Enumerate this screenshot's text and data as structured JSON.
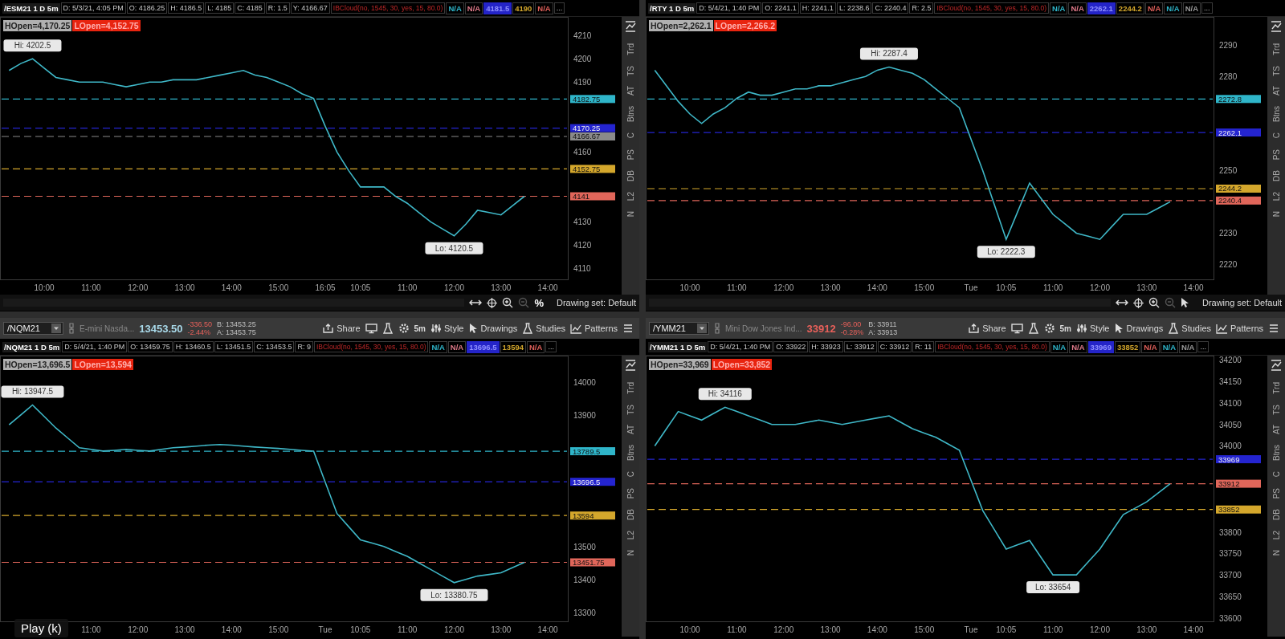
{
  "panels": [
    {
      "info_bar": {
        "symbol": "/ESM21 1 D 5m",
        "fields": [
          "D: 5/3/21, 4:05 PM",
          "O: 4186.25",
          "H: 4186.5",
          "L: 4185",
          "C: 4185",
          "R: 1.5",
          "Y: 4166.67"
        ],
        "study": "IBCloud(no, 1545, 30, yes, 15, 80.0)",
        "values": [
          {
            "text": "N/A",
            "color": "#2fb5c9",
            "highlight": false
          },
          {
            "text": "N/A",
            "color": "#e07a8a",
            "highlight": false
          },
          {
            "text": "4181.5",
            "color": "#2424c8",
            "highlight": true
          },
          {
            "text": "4190",
            "color": "#d4a72c",
            "highlight": false
          },
          {
            "text": "N/A",
            "color": "#e0605a",
            "highlight": false
          }
        ],
        "more": "..."
      },
      "open_labels": [
        {
          "text": "HOpen=4,170.25",
          "color": "#b0b0b0"
        },
        {
          "text": "LOpen=4,152.75",
          "color": "#e8240f"
        }
      ],
      "extremes": {
        "high": "Hi: 4202.5",
        "low": "Lo: 4120.5"
      },
      "side_tabs": [
        "Trd",
        "TS",
        "AT",
        "Btns",
        "C",
        "PS",
        "DB",
        "L2",
        "N"
      ],
      "chart_data": {
        "type": "line",
        "categories": [
          null,
          null,
          null,
          "10:00",
          null,
          null,
          null,
          "11:00",
          null,
          null,
          null,
          "12:00",
          null,
          null,
          null,
          "13:00",
          null,
          null,
          null,
          "14:00",
          null,
          null,
          null,
          "15:00",
          null,
          null,
          null,
          "16:05",
          null,
          null,
          "10:05",
          null,
          null,
          null,
          "11:00",
          null,
          null,
          null,
          "12:00",
          null,
          null,
          null,
          "13:00",
          null,
          null,
          null,
          "14:00",
          null
        ],
        "series": [
          {
            "color": "#3fb8c8",
            "values": [
              4195,
              4198,
              4200,
              4196,
              4192,
              4191,
              4190,
              4190,
              4190,
              4189,
              4188,
              4189,
              4190,
              4190,
              4191,
              4191,
              4191,
              4192,
              4193,
              4194,
              4195,
              4193,
              4192,
              4190,
              4188,
              4185,
              4183,
              4171,
              4160,
              4152,
              4145,
              4145,
              4145,
              4141,
              4138,
              4134,
              4130,
              4127,
              4124,
              4129,
              4135,
              4134,
              4133,
              4137,
              4141,
              null,
              null,
              null
            ]
          }
        ],
        "ylim": [
          4105,
          4218
        ],
        "yticks": [
          4110,
          4120,
          4130,
          4160,
          4190,
          4200,
          4210
        ],
        "ref_lines": [
          {
            "axis": "y",
            "value": 4182.75,
            "label": "4182.75",
            "color": "#2fb5c9"
          },
          {
            "axis": "y",
            "value": 4170.25,
            "label": "4170.25",
            "color": "#2424d0"
          },
          {
            "axis": "y",
            "value": 4166.67,
            "label": "4166.67",
            "color": "#8a8a8a"
          },
          {
            "axis": "y",
            "value": 4152.75,
            "label": "4152.75",
            "color": "#d4a72c"
          },
          {
            "axis": "y",
            "value": 4141,
            "label": "4141",
            "color": "#e0665a"
          }
        ]
      },
      "footer": {
        "extra_text": "%",
        "drawing_set": "Drawing set: Default"
      }
    },
    {
      "info_bar": {
        "symbol": "/RTY 1 D 5m",
        "fields": [
          "D: 5/4/21, 1:40 PM",
          "O: 2241.1",
          "H: 2241.1",
          "L: 2238.6",
          "C: 2240.4",
          "R: 2.5"
        ],
        "study": "IBCloud(no, 1545, 30, yes, 15, 80.0)",
        "values": [
          {
            "text": "N/A",
            "color": "#2fb5c9",
            "highlight": false
          },
          {
            "text": "N/A",
            "color": "#e07a8a",
            "highlight": false
          },
          {
            "text": "2262.1",
            "color": "#2424c8",
            "highlight": true
          },
          {
            "text": "2244.2",
            "color": "#d4a72c",
            "highlight": false
          },
          {
            "text": "N/A",
            "color": "#e0605a",
            "highlight": false
          },
          {
            "text": "N/A",
            "color": "#2fb5c9",
            "highlight": false
          },
          {
            "text": "N/A",
            "color": "#9a9a9a",
            "highlight": false
          }
        ],
        "more": "..."
      },
      "open_labels": [
        {
          "text": "HOpen=2,262.1",
          "color": "#b0b0b0"
        },
        {
          "text": "LOpen=2,266.2",
          "color": "#e8240f"
        }
      ],
      "extremes": {
        "high": "Hi: 2287.4",
        "low": "Lo: 2222.3"
      },
      "side_tabs": [
        "Trd",
        "TS",
        "AT",
        "Btns",
        "C",
        "PS",
        "DB",
        "L2",
        "N"
      ],
      "chart_data": {
        "type": "line",
        "categories": [
          null,
          null,
          null,
          "10:00",
          null,
          null,
          null,
          "11:00",
          null,
          null,
          null,
          "12:00",
          null,
          null,
          null,
          "13:00",
          null,
          null,
          null,
          "14:00",
          null,
          null,
          null,
          "15:00",
          null,
          null,
          null,
          "Tue",
          null,
          null,
          "10:05",
          null,
          null,
          null,
          "11:00",
          null,
          null,
          null,
          "12:00",
          null,
          null,
          null,
          "13:00",
          null,
          null,
          null,
          "14:00",
          null
        ],
        "series": [
          {
            "color": "#3fb8c8",
            "values": [
              2282,
              2277,
              2272,
              2268,
              2265,
              2268,
              2270,
              2273,
              2275,
              2274,
              2274,
              2275,
              2276,
              2276,
              2277,
              2277,
              2278,
              2279,
              2280,
              2282,
              2283,
              2282,
              2281,
              2279,
              2276,
              2273,
              2270,
              2260,
              2250,
              2239,
              2228,
              2237,
              2246,
              2241,
              2236,
              2233,
              2230,
              2229,
              2228,
              2232,
              2236,
              2236,
              2236,
              2238,
              2240,
              null,
              null,
              null
            ]
          }
        ],
        "ylim": [
          2215,
          2299
        ],
        "yticks": [
          2220,
          2230,
          2250,
          2280,
          2290
        ],
        "ref_lines": [
          {
            "axis": "y",
            "value": 2272.8,
            "label": "2272.8",
            "color": "#2fb5c9"
          },
          {
            "axis": "y",
            "value": 2262.1,
            "label": "2262.1",
            "color": "#2424d0"
          },
          {
            "axis": "y",
            "value": 2244.2,
            "label": "2244.2",
            "color": "#d4a72c"
          },
          {
            "axis": "y",
            "value": 2240.4,
            "label": "2240.4",
            "color": "#e0665a"
          }
        ]
      },
      "footer": {
        "drawing_set": "Drawing set: Default"
      }
    },
    {
      "toolbar": {
        "symbol": "/NQM21",
        "description": "E-mini Nasda...",
        "last": {
          "text": "13453.50",
          "color": "#a8d8e8"
        },
        "change": "-336.50",
        "change_pct": "-2.44%",
        "bid": "B: 13453.25",
        "ask": "A: 13453.75",
        "buttons": [
          {
            "kind": "share",
            "label": "Share"
          },
          {
            "kind": "screen"
          },
          {
            "kind": "flask"
          },
          {
            "kind": "gear"
          },
          {
            "kind": "interval",
            "label": "5m"
          },
          {
            "kind": "style",
            "label": "Style"
          },
          {
            "kind": "pointer",
            "label": "Drawings"
          },
          {
            "kind": "flask",
            "label": "Studies"
          },
          {
            "kind": "pattern",
            "label": "Patterns"
          },
          {
            "kind": "menu"
          }
        ]
      },
      "info_bar": {
        "symbol": "/NQM21 1 D 5m",
        "fields": [
          "D: 5/4/21, 1:40 PM",
          "O: 13459.75",
          "H: 13460.5",
          "L: 13451.5",
          "C: 13453.5",
          "R: 9"
        ],
        "study": "IBCloud(no, 1545, 30, yes, 15, 80.0)",
        "values": [
          {
            "text": "N/A",
            "color": "#2fb5c9",
            "highlight": false
          },
          {
            "text": "N/A",
            "color": "#e07a8a",
            "highlight": false
          },
          {
            "text": "13696.5",
            "color": "#2424c8",
            "highlight": true
          },
          {
            "text": "13594",
            "color": "#d4a72c",
            "highlight": false
          },
          {
            "text": "N/A",
            "color": "#e0605a",
            "highlight": false
          }
        ],
        "more": "..."
      },
      "open_labels": [
        {
          "text": "HOpen=13,696.5",
          "color": "#b0b0b0"
        },
        {
          "text": "LOpen=13,594",
          "color": "#e8240f"
        }
      ],
      "extremes": {
        "high": "Hi: 13947.5",
        "low": "Lo: 13380.75"
      },
      "side_tabs": [
        "Trd",
        "TS",
        "AT",
        "Btns",
        "C",
        "PS",
        "DB",
        "L2",
        "N"
      ],
      "chart_data": {
        "type": "line",
        "categories": [
          null,
          null,
          null,
          null,
          null,
          null,
          null,
          "11:00",
          null,
          null,
          null,
          "12:00",
          null,
          null,
          null,
          "13:00",
          null,
          null,
          null,
          "14:00",
          null,
          null,
          null,
          "15:00",
          null,
          null,
          null,
          "Tue",
          null,
          null,
          "10:05",
          null,
          null,
          null,
          "11:00",
          null,
          null,
          null,
          "12:00",
          null,
          null,
          null,
          "13:00",
          null,
          null,
          null,
          "14:00",
          null
        ],
        "series": [
          {
            "color": "#3fb8c8",
            "values": [
              13870,
              13900,
              13930,
              13895,
              13860,
              13830,
              13800,
              13795,
              13790,
              13792,
              13795,
              13792,
              13790,
              13795,
              13800,
              13802,
              13805,
              13808,
              13810,
              13808,
              13805,
              13802,
              13800,
              13798,
              13795,
              13792,
              13790,
              13695,
              13600,
              13560,
              13520,
              13510,
              13500,
              13485,
              13470,
              13450,
              13430,
              13410,
              13390,
              13400,
              13410,
              13415,
              13420,
              13436,
              13452,
              null,
              null,
              null
            ]
          }
        ],
        "ylim": [
          13270,
          14080
        ],
        "yticks": [
          13300,
          13400,
          13500,
          13900,
          14000
        ],
        "ref_lines": [
          {
            "axis": "y",
            "value": 13789.5,
            "label": "13789.5",
            "color": "#2fb5c9"
          },
          {
            "axis": "y",
            "value": 13696.5,
            "label": "13696.5",
            "color": "#2424d0"
          },
          {
            "axis": "y",
            "value": 13594,
            "label": "13594",
            "color": "#d4a72c"
          },
          {
            "axis": "y",
            "value": 13451.75,
            "label": "13451.75",
            "color": "#e0665a"
          }
        ]
      }
    },
    {
      "toolbar": {
        "symbol": "/YMM21",
        "description": "Mini Dow Jones Ind...",
        "last": {
          "text": "33912",
          "color": "#e8605a"
        },
        "change": "-96.00",
        "change_pct": "-0.28%",
        "bid": "B: 33911",
        "ask": "A: 33913",
        "buttons": [
          {
            "kind": "share",
            "label": "Share"
          },
          {
            "kind": "screen"
          },
          {
            "kind": "flask"
          },
          {
            "kind": "gear"
          },
          {
            "kind": "interval",
            "label": "5m"
          },
          {
            "kind": "style",
            "label": "Style"
          },
          {
            "kind": "pointer",
            "label": "Drawings"
          },
          {
            "kind": "flask",
            "label": "Studies"
          },
          {
            "kind": "pattern",
            "label": "Patterns"
          },
          {
            "kind": "menu"
          }
        ]
      },
      "info_bar": {
        "symbol": "/YMM21 1 D 5m",
        "fields": [
          "D: 5/4/21, 1:40 PM",
          "O: 33922",
          "H: 33923",
          "L: 33912",
          "C: 33912",
          "R: 11"
        ],
        "study": "IBCloud(no, 1545, 30, yes, 15, 80.0)",
        "values": [
          {
            "text": "N/A",
            "color": "#2fb5c9",
            "highlight": false
          },
          {
            "text": "N/A",
            "color": "#e07a8a",
            "highlight": false
          },
          {
            "text": "33969",
            "color": "#2424c8",
            "highlight": true
          },
          {
            "text": "33852",
            "color": "#d4a72c",
            "highlight": false
          },
          {
            "text": "N/A",
            "color": "#e0605a",
            "highlight": false
          },
          {
            "text": "N/A",
            "color": "#2fb5c9",
            "highlight": false
          },
          {
            "text": "N/A",
            "color": "#9a9a9a",
            "highlight": false
          }
        ],
        "more": "..."
      },
      "open_labels": [
        {
          "text": "HOpen=33,969",
          "color": "#b0b0b0"
        },
        {
          "text": "LOpen=33,852",
          "color": "#e8240f"
        }
      ],
      "extremes": {
        "high": "Hi: 34116",
        "low": "Lo: 33654"
      },
      "side_tabs": [
        "Trd",
        "TS",
        "AT",
        "Btns",
        "C",
        "PS",
        "DB",
        "L2",
        "N"
      ],
      "chart_data": {
        "type": "line",
        "categories": [
          null,
          null,
          null,
          "10:00",
          null,
          null,
          null,
          "11:00",
          null,
          null,
          null,
          "12:00",
          null,
          null,
          null,
          "13:00",
          null,
          null,
          null,
          "14:00",
          null,
          null,
          null,
          "15:00",
          null,
          null,
          null,
          "Tue",
          null,
          null,
          "10:05",
          null,
          null,
          null,
          "11:00",
          null,
          null,
          null,
          "12:00",
          null,
          null,
          null,
          "13:00",
          null,
          null,
          null,
          "14:00",
          null
        ],
        "series": [
          {
            "color": "#3fb8c8",
            "values": [
              34000,
              34040,
              34080,
              34070,
              34060,
              34075,
              34090,
              34080,
              34070,
              34060,
              34050,
              34050,
              34050,
              34055,
              34060,
              34055,
              34050,
              34055,
              34060,
              34065,
              34070,
              34055,
              34040,
              34030,
              34020,
              34005,
              33990,
              33920,
              33850,
              33805,
              33760,
              33770,
              33780,
              33740,
              33700,
              33700,
              33700,
              33730,
              33760,
              33800,
              33840,
              33855,
              33870,
              33891,
              33912,
              null,
              null,
              null
            ]
          }
        ],
        "ylim": [
          33590,
          34210
        ],
        "yticks": [
          33600,
          33650,
          33700,
          33750,
          33800,
          34000,
          34050,
          34100,
          34150,
          34200
        ],
        "ref_lines": [
          {
            "axis": "y",
            "value": 33969,
            "label": "33969",
            "color": "#2424d0"
          },
          {
            "axis": "y",
            "value": 33912,
            "label": "33912",
            "color": "#e0665a"
          },
          {
            "axis": "y",
            "value": 33852,
            "label": "33852",
            "color": "#d4a72c"
          }
        ]
      }
    }
  ],
  "overlay": {
    "text": "Play (k)"
  }
}
